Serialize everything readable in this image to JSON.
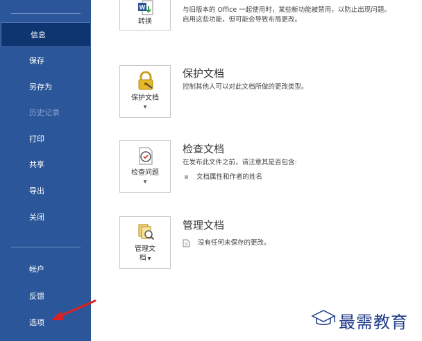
{
  "sidebar": {
    "items": [
      {
        "label": "信息",
        "selected": true
      },
      {
        "label": "保存"
      },
      {
        "label": "另存为"
      },
      {
        "label": "历史记录",
        "disabled": true
      },
      {
        "label": "打印"
      },
      {
        "label": "共享"
      },
      {
        "label": "导出"
      },
      {
        "label": "关闭"
      }
    ],
    "bottom_items": [
      {
        "label": "帐户"
      },
      {
        "label": "反馈"
      },
      {
        "label": "选项"
      }
    ]
  },
  "sections": {
    "convert": {
      "button_label": "转换",
      "desc_line1": "与旧版本的 Office 一起使用时，某些新功能被禁用，以防止出现问题。",
      "desc_line2": "启用这些功能，但可能会导致布局更改。"
    },
    "protect": {
      "button_label": "保护文档",
      "title": "保护文档",
      "desc": "控制其他人可以对此文档所做的更改类型。"
    },
    "inspect": {
      "button_label": "检查问题",
      "title": "检查文档",
      "desc": "在发布此文件之前，请注意其是否包含:",
      "bullet": "文档属性和作者的姓名"
    },
    "manage": {
      "button_label_line1": "管理文",
      "button_label_line2": "档",
      "title": "管理文档",
      "desc": "没有任何未保存的更改。"
    }
  },
  "watermark": {
    "text": "最需教育"
  },
  "colors": {
    "sidebar": "#2b579a",
    "selected": "#0f3570",
    "arrow": "#e02020"
  }
}
